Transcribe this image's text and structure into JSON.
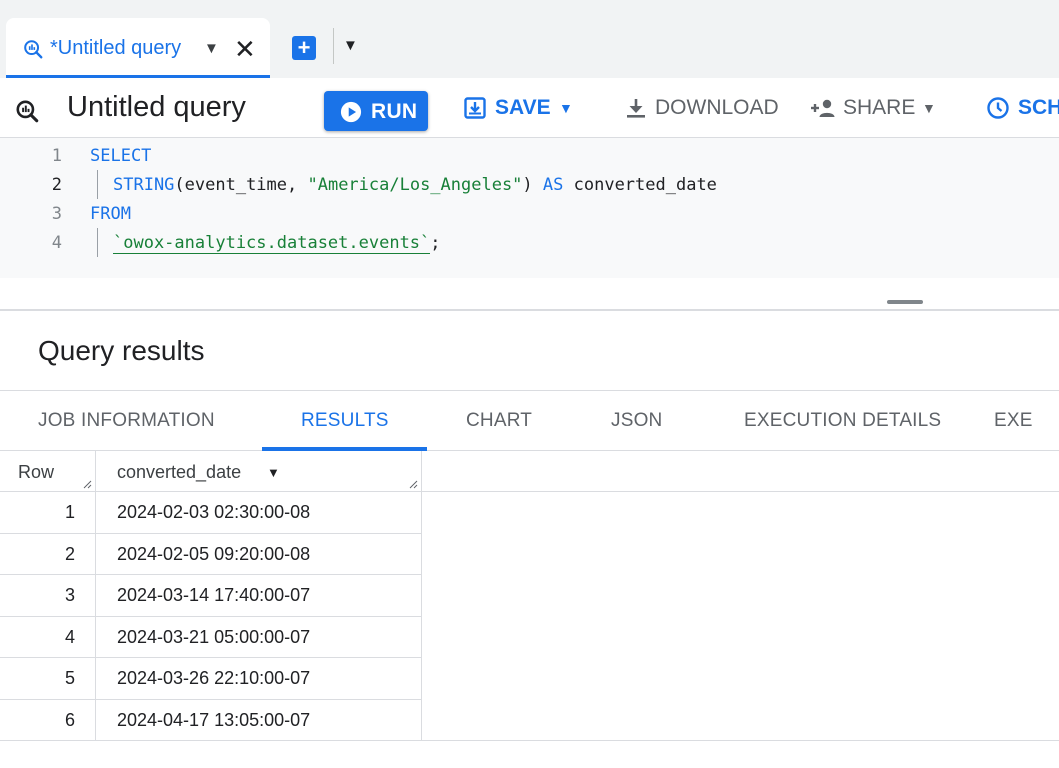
{
  "tabstrip": {
    "tab_title": "*Untitled query"
  },
  "toolbar": {
    "query_title": "Untitled query",
    "run_label": "RUN",
    "save_label": "SAVE",
    "download_label": "DOWNLOAD",
    "share_label": "SHARE",
    "schedule_label": "SCH"
  },
  "editor": {
    "line_numbers": [
      "1",
      "2",
      "3",
      "4"
    ],
    "line1_kw": "SELECT",
    "line2_fn": "STRING",
    "line2_open": "(event_time, ",
    "line2_str": "\"America/Los_Angeles\"",
    "line2_close": ") ",
    "line2_kw": "AS",
    "line2_alias": " converted_date",
    "line3_kw": "FROM",
    "line4_table": "`owox-analytics.dataset.events`",
    "line4_end": ";"
  },
  "results": {
    "title": "Query results",
    "tabs": [
      "JOB INFORMATION",
      "RESULTS",
      "CHART",
      "JSON",
      "EXECUTION DETAILS",
      "EXE"
    ],
    "active_tab": "RESULTS",
    "columns": [
      "Row",
      "converted_date"
    ],
    "rows": [
      {
        "num": "1",
        "date": "2024-02-03 02:30:00-08"
      },
      {
        "num": "2",
        "date": "2024-02-05 09:20:00-08"
      },
      {
        "num": "3",
        "date": "2024-03-14 17:40:00-07"
      },
      {
        "num": "4",
        "date": "2024-03-21 05:00:00-07"
      },
      {
        "num": "5",
        "date": "2024-03-26 22:10:00-07"
      },
      {
        "num": "6",
        "date": "2024-04-17 13:05:00-07"
      }
    ]
  },
  "icons": {
    "query": "query-icon",
    "run": "play-circle-icon",
    "save": "save-icon",
    "download": "download-icon",
    "share": "add-person-icon",
    "schedule": "clock-icon"
  },
  "colors": {
    "accent": "#1a73e8",
    "string": "#188038",
    "tabstrip_bg": "#f1f3f4",
    "editor_bg": "#f8f9fa"
  }
}
